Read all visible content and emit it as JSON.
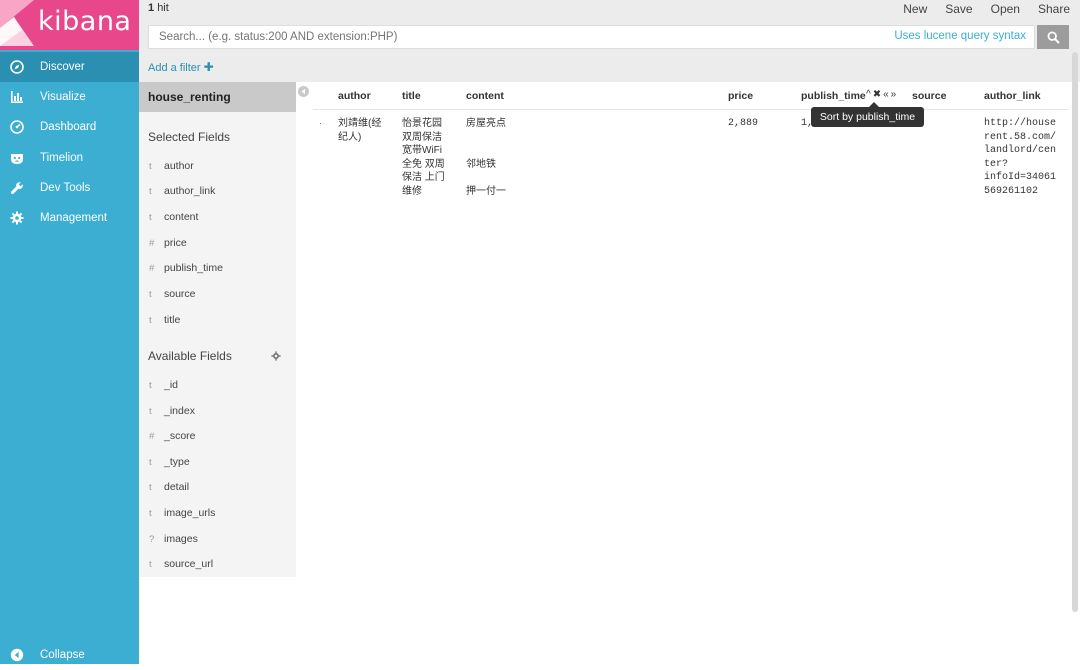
{
  "nav": {
    "logo_text": "kibana",
    "items": [
      {
        "label": "Discover",
        "icon": "compass-icon",
        "active": true
      },
      {
        "label": "Visualize",
        "icon": "bar-chart-icon"
      },
      {
        "label": "Dashboard",
        "icon": "dashboard-icon"
      },
      {
        "label": "Timelion",
        "icon": "timelion-icon"
      },
      {
        "label": "Dev Tools",
        "icon": "wrench-icon"
      },
      {
        "label": "Management",
        "icon": "gear-icon"
      }
    ],
    "collapse_label": "Collapse"
  },
  "topbar": {
    "hits_count": "1",
    "hits_label": "hit",
    "menu": [
      "New",
      "Save",
      "Open",
      "Share"
    ],
    "search_placeholder": "Search... (e.g. status:200 AND extension:PHP)",
    "lucene_link": "Uses lucene query syntax",
    "add_filter": "Add a filter"
  },
  "sidebar": {
    "index_name": "house_renting",
    "selected_title": "Selected Fields",
    "selected_fields": [
      {
        "type": "t",
        "name": "author"
      },
      {
        "type": "t",
        "name": "author_link"
      },
      {
        "type": "t",
        "name": "content"
      },
      {
        "type": "#",
        "name": "price"
      },
      {
        "type": "#",
        "name": "publish_time"
      },
      {
        "type": "t",
        "name": "source"
      },
      {
        "type": "t",
        "name": "title"
      }
    ],
    "available_title": "Available Fields",
    "available_fields": [
      {
        "type": "t",
        "name": "_id"
      },
      {
        "type": "t",
        "name": "_index"
      },
      {
        "type": "#",
        "name": "_score"
      },
      {
        "type": "t",
        "name": "_type"
      },
      {
        "type": "t",
        "name": "detail"
      },
      {
        "type": "t",
        "name": "image_urls"
      },
      {
        "type": "?",
        "name": "images"
      },
      {
        "type": "t",
        "name": "source_url"
      }
    ]
  },
  "table": {
    "columns": [
      "author",
      "title",
      "content",
      "price",
      "publish_time",
      "source",
      "author_link"
    ],
    "sort_buttons": [
      "^",
      "✖",
      "«",
      "»"
    ],
    "tooltip": "Sort by publish_time",
    "row": {
      "expand": "·",
      "author": [
        "刘靖维(经",
        "纪人)"
      ],
      "title": [
        "怡景花园",
        "双周保洁",
        "宽带WiFi",
        "全免 双周",
        "保洁 上门",
        "维修"
      ],
      "content": [
        "房屋亮点",
        "",
        "",
        "邻地铁",
        "",
        "押一付一"
      ],
      "price": "2,889",
      "publish_time": "1,",
      "source": "",
      "author_link": [
        "http://house",
        "rent.58.com/",
        "landlord/cen",
        "ter?",
        "infoId=34061",
        "569261102"
      ]
    }
  }
}
